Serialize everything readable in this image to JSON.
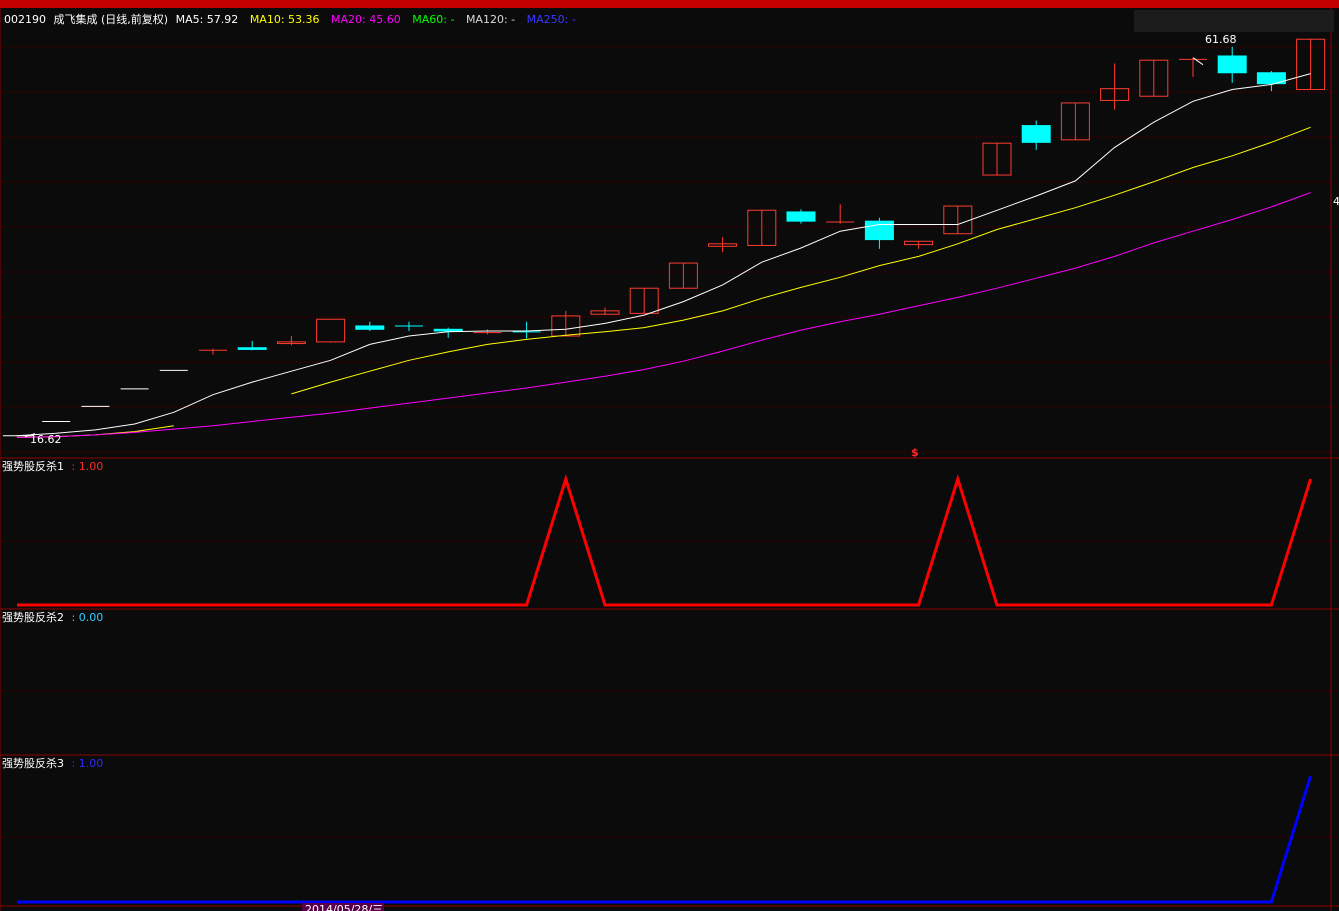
{
  "header": {
    "symbol": "002190",
    "name": "成飞集成",
    "mode": "(日线,前复权)",
    "ma": [
      {
        "label": "MA5: 57.92",
        "color": "#ffffff"
      },
      {
        "label": "MA10: 53.36",
        "color": "#ffff00"
      },
      {
        "label": "MA20: 45.60",
        "color": "#ff00ff"
      },
      {
        "label": "MA60: -",
        "color": "#00ff00"
      },
      {
        "label": "MA120: -",
        "color": "#d8d8d8"
      },
      {
        "label": "MA250: -",
        "color": "#3a3aff"
      }
    ]
  },
  "annotations": {
    "high_label": "61.68",
    "low_label": "16.62",
    "right_edge_tick": "4",
    "signal_glyph": "$",
    "bottom_date": "2014/05/28/三"
  },
  "colors": {
    "up": "#ff3b30",
    "down": "#00ffff",
    "grid": "#5a0000",
    "panel_border": "#8b0000",
    "background": "#0b0b0b"
  },
  "chart_data": [
    {
      "type": "candlestick",
      "title": "002190 成飞集成(日线,前复权)",
      "ylim": [
        15.5,
        65
      ],
      "candles": [
        {
          "o": 16.6,
          "h": 16.7,
          "l": 16.5,
          "c": 16.6
        },
        {
          "o": 18.3,
          "h": 18.3,
          "l": 18.3,
          "c": 18.3
        },
        {
          "o": 20.1,
          "h": 20.1,
          "l": 20.1,
          "c": 20.1
        },
        {
          "o": 22.2,
          "h": 22.2,
          "l": 22.2,
          "c": 22.2
        },
        {
          "o": 24.4,
          "h": 24.4,
          "l": 24.4,
          "c": 24.4
        },
        {
          "o": 26.8,
          "h": 27.0,
          "l": 26.3,
          "c": 26.8
        },
        {
          "o": 27.1,
          "h": 27.9,
          "l": 26.8,
          "c": 26.9
        },
        {
          "o": 27.6,
          "h": 28.5,
          "l": 27.4,
          "c": 27.8
        },
        {
          "o": 27.8,
          "h": 27.8,
          "l": 27.7,
          "c": 30.5
        },
        {
          "o": 29.7,
          "h": 30.2,
          "l": 29.1,
          "c": 29.3
        },
        {
          "o": 29.7,
          "h": 30.2,
          "l": 29.1,
          "c": 29.6
        },
        {
          "o": 29.3,
          "h": 29.5,
          "l": 28.3,
          "c": 29.1
        },
        {
          "o": 28.9,
          "h": 29.3,
          "l": 28.7,
          "c": 28.9
        },
        {
          "o": 29.0,
          "h": 30.2,
          "l": 28.2,
          "c": 28.9
        },
        {
          "o": 28.5,
          "h": 31.5,
          "l": 28.5,
          "c": 30.9
        },
        {
          "o": 31.1,
          "h": 31.9,
          "l": 31.0,
          "c": 31.5
        },
        {
          "o": 31.2,
          "h": 34.2,
          "l": 31.2,
          "c": 34.2
        },
        {
          "o": 34.2,
          "h": 37.2,
          "l": 34.2,
          "c": 37.2
        },
        {
          "o": 39.2,
          "h": 40.3,
          "l": 38.5,
          "c": 39.5
        },
        {
          "o": 39.3,
          "h": 43.5,
          "l": 39.3,
          "c": 43.5
        },
        {
          "o": 43.3,
          "h": 43.6,
          "l": 41.9,
          "c": 42.2
        },
        {
          "o": 42.1,
          "h": 44.2,
          "l": 41.9,
          "c": 42.1
        },
        {
          "o": 42.2,
          "h": 42.6,
          "l": 38.9,
          "c": 40.0
        },
        {
          "o": 39.4,
          "h": 39.8,
          "l": 38.9,
          "c": 39.8
        },
        {
          "o": 40.7,
          "h": 44.0,
          "l": 40.7,
          "c": 44.0
        },
        {
          "o": 47.7,
          "h": 51.5,
          "l": 47.7,
          "c": 51.5
        },
        {
          "o": 53.6,
          "h": 54.2,
          "l": 50.7,
          "c": 51.6
        },
        {
          "o": 51.9,
          "h": 56.3,
          "l": 51.9,
          "c": 56.3
        },
        {
          "o": 56.6,
          "h": 61.0,
          "l": 55.5,
          "c": 58.0
        },
        {
          "o": 57.1,
          "h": 61.4,
          "l": 57.1,
          "c": 61.4
        },
        {
          "o": 61.5,
          "h": 61.7,
          "l": 59.4,
          "c": 61.5
        },
        {
          "o": 61.9,
          "h": 63.0,
          "l": 58.7,
          "c": 59.9
        },
        {
          "o": 59.9,
          "h": 60.1,
          "l": 57.7,
          "c": 58.6
        },
        {
          "o": 57.9,
          "h": 63.9,
          "l": 57.9,
          "c": 63.9
        }
      ],
      "series": [
        {
          "name": "MA5",
          "color": "#ffffff",
          "values": [
            16.6,
            16.9,
            17.3,
            18.0,
            19.4,
            21.5,
            23.0,
            24.3,
            25.6,
            27.5,
            28.5,
            29.0,
            29.1,
            29.1,
            29.3,
            30.0,
            31.0,
            32.6,
            34.6,
            37.3,
            39.0,
            41.0,
            41.8,
            41.8,
            41.8,
            43.5,
            45.2,
            47.0,
            51.0,
            54.0,
            56.5,
            57.9,
            58.5,
            59.8
          ]
        },
        {
          "name": "MA10",
          "color": "#ffff00",
          "values": [
            16.4,
            16.5,
            16.7,
            17.1,
            17.8,
            null,
            null,
            21.6,
            23.0,
            24.3,
            25.6,
            26.6,
            27.5,
            28.1,
            28.6,
            29.0,
            29.5,
            30.4,
            31.5,
            33.0,
            34.3,
            35.5,
            36.9,
            38.0,
            39.5,
            41.2,
            42.5,
            43.8,
            45.3,
            46.9,
            48.6,
            50.0,
            51.6,
            53.4
          ]
        },
        {
          "name": "MA20",
          "color": "#ff00ff",
          "values": [
            16.4,
            16.5,
            16.7,
            17.0,
            17.4,
            17.8,
            18.3,
            18.8,
            19.3,
            19.9,
            20.5,
            21.1,
            21.7,
            22.3,
            23.0,
            23.7,
            24.5,
            25.5,
            26.7,
            28.0,
            29.2,
            30.2,
            31.1,
            32.1,
            33.1,
            34.2,
            35.4,
            36.6,
            38.0,
            39.6,
            41.0,
            42.4,
            43.9,
            45.6
          ]
        }
      ]
    },
    {
      "type": "line",
      "title": "强势股反杀1",
      "value_label": ": 1.00",
      "label_color": "#ff2a2a",
      "color": "#ff0000",
      "ylim": [
        0,
        1
      ],
      "x": [
        0,
        13,
        14,
        15,
        23,
        24,
        25,
        32,
        33
      ],
      "values": [
        0,
        0,
        1,
        0,
        0,
        1,
        0,
        0,
        1
      ]
    },
    {
      "type": "line",
      "title": "强势股反杀2",
      "value_label": ": 0.00",
      "label_color": "#33ccff",
      "color": "#33ccff",
      "ylim": [
        0,
        1
      ],
      "x": [],
      "values": []
    },
    {
      "type": "line",
      "title": "强势股反杀3",
      "value_label": ": 1.00",
      "label_color": "#2a2aff",
      "color": "#0000ff",
      "ylim": [
        0,
        1
      ],
      "x": [
        0,
        32,
        33
      ],
      "values": [
        0,
        0,
        1
      ]
    }
  ]
}
